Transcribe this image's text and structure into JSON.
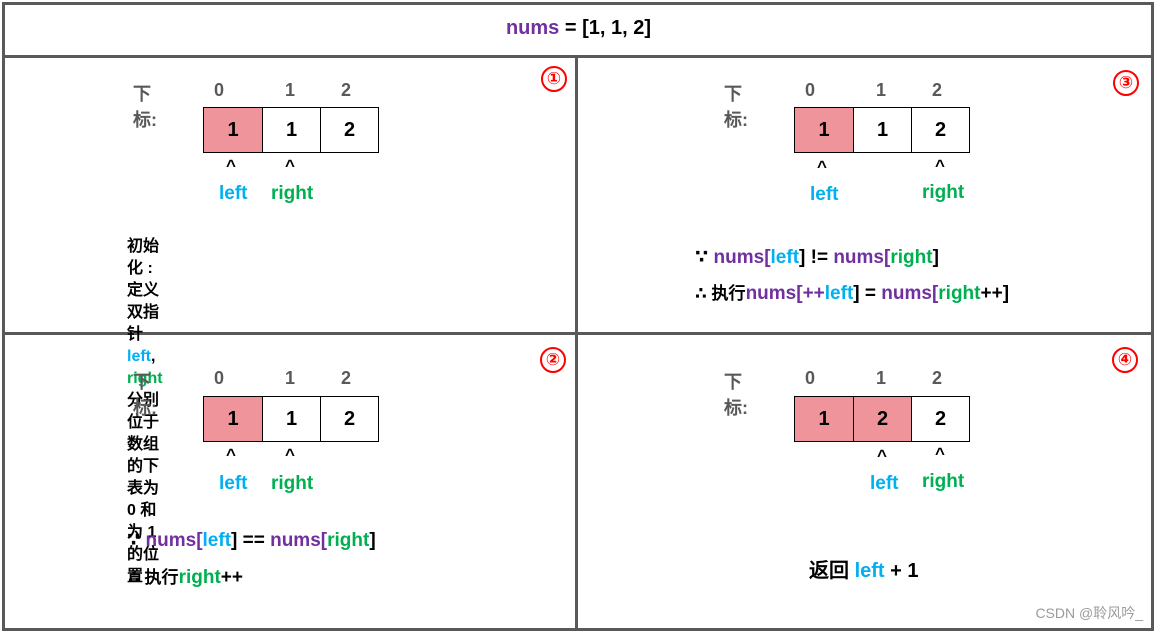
{
  "title": {
    "lhs": "nums",
    "rhs": " = [1, 1, 2]"
  },
  "index_label": "下标:",
  "indices": [
    "0",
    "1",
    "2"
  ],
  "caret": "^",
  "pointer_labels": {
    "left": "left",
    "right": "right"
  },
  "colors": {
    "nums": "#7030a0",
    "left": "#00b0f0",
    "right": "#00b050",
    "highlight": "#f0949b",
    "badge": "#ff0000",
    "grid": "#595959"
  },
  "panels": [
    {
      "badge": "①",
      "cells": [
        {
          "value": "1",
          "highlighted": true
        },
        {
          "value": "1",
          "highlighted": false
        },
        {
          "value": "2",
          "highlighted": false
        }
      ],
      "left_index": 0,
      "right_index": 1,
      "note": {
        "prefix": "初始化 :定义双指针",
        "left": "left",
        "sep": ", ",
        "right": "right",
        "suffix": " 分别位于",
        "line2": "数组的下表为 0 和为 1 的位置"
      }
    },
    {
      "badge": "②",
      "cells": [
        {
          "value": "1",
          "highlighted": true
        },
        {
          "value": "1",
          "highlighted": false
        },
        {
          "value": "2",
          "highlighted": false
        }
      ],
      "left_index": 0,
      "right_index": 1,
      "cond": {
        "because": "∵ ",
        "nums1": "nums",
        "ob1": "[",
        "left": "left",
        "cb1": "]",
        "op": " == ",
        "nums2": "nums",
        "ob2": "[",
        "right": "right",
        "cb2": "]"
      },
      "action": {
        "therefore": "∴ 执行",
        "right": "right",
        "suffix": "++"
      }
    },
    {
      "badge": "③",
      "cells": [
        {
          "value": "1",
          "highlighted": true
        },
        {
          "value": "1",
          "highlighted": false
        },
        {
          "value": "2",
          "highlighted": false
        }
      ],
      "left_index": 0,
      "right_index": 2,
      "cond": {
        "because": "∵ ",
        "nums1": "nums",
        "ob1": "[",
        "left": "left",
        "cb1": "]",
        "op": " != ",
        "nums2": "nums",
        "ob2": "[",
        "right": "right",
        "cb2": "]"
      },
      "action": {
        "therefore": "∴ 执行",
        "nums1": "nums",
        "ob1": "[++",
        "left": "left",
        "cb1": "]",
        "op": " = ",
        "nums2": "nums",
        "ob2": "[",
        "right": "right",
        "cb2": "++]"
      }
    },
    {
      "badge": "④",
      "cells": [
        {
          "value": "1",
          "highlighted": true
        },
        {
          "value": "2",
          "highlighted": true
        },
        {
          "value": "2",
          "highlighted": false
        }
      ],
      "left_index": 1,
      "right_index": 2,
      "result": {
        "prefix": "返回 ",
        "left": "left",
        "suffix": " + 1"
      }
    }
  ],
  "watermark": "CSDN @聆风吟_"
}
